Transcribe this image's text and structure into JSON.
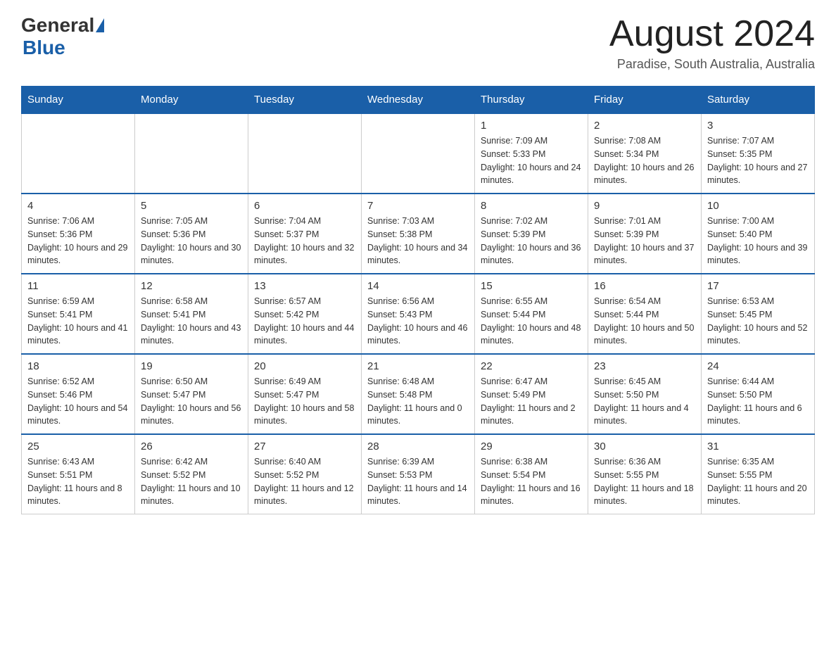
{
  "logo": {
    "general": "General",
    "blue": "Blue"
  },
  "header": {
    "title": "August 2024",
    "subtitle": "Paradise, South Australia, Australia"
  },
  "days_of_week": [
    "Sunday",
    "Monday",
    "Tuesday",
    "Wednesday",
    "Thursday",
    "Friday",
    "Saturday"
  ],
  "weeks": [
    [
      {
        "day": "",
        "info": ""
      },
      {
        "day": "",
        "info": ""
      },
      {
        "day": "",
        "info": ""
      },
      {
        "day": "",
        "info": ""
      },
      {
        "day": "1",
        "info": "Sunrise: 7:09 AM\nSunset: 5:33 PM\nDaylight: 10 hours and 24 minutes."
      },
      {
        "day": "2",
        "info": "Sunrise: 7:08 AM\nSunset: 5:34 PM\nDaylight: 10 hours and 26 minutes."
      },
      {
        "day": "3",
        "info": "Sunrise: 7:07 AM\nSunset: 5:35 PM\nDaylight: 10 hours and 27 minutes."
      }
    ],
    [
      {
        "day": "4",
        "info": "Sunrise: 7:06 AM\nSunset: 5:36 PM\nDaylight: 10 hours and 29 minutes."
      },
      {
        "day": "5",
        "info": "Sunrise: 7:05 AM\nSunset: 5:36 PM\nDaylight: 10 hours and 30 minutes."
      },
      {
        "day": "6",
        "info": "Sunrise: 7:04 AM\nSunset: 5:37 PM\nDaylight: 10 hours and 32 minutes."
      },
      {
        "day": "7",
        "info": "Sunrise: 7:03 AM\nSunset: 5:38 PM\nDaylight: 10 hours and 34 minutes."
      },
      {
        "day": "8",
        "info": "Sunrise: 7:02 AM\nSunset: 5:39 PM\nDaylight: 10 hours and 36 minutes."
      },
      {
        "day": "9",
        "info": "Sunrise: 7:01 AM\nSunset: 5:39 PM\nDaylight: 10 hours and 37 minutes."
      },
      {
        "day": "10",
        "info": "Sunrise: 7:00 AM\nSunset: 5:40 PM\nDaylight: 10 hours and 39 minutes."
      }
    ],
    [
      {
        "day": "11",
        "info": "Sunrise: 6:59 AM\nSunset: 5:41 PM\nDaylight: 10 hours and 41 minutes."
      },
      {
        "day": "12",
        "info": "Sunrise: 6:58 AM\nSunset: 5:41 PM\nDaylight: 10 hours and 43 minutes."
      },
      {
        "day": "13",
        "info": "Sunrise: 6:57 AM\nSunset: 5:42 PM\nDaylight: 10 hours and 44 minutes."
      },
      {
        "day": "14",
        "info": "Sunrise: 6:56 AM\nSunset: 5:43 PM\nDaylight: 10 hours and 46 minutes."
      },
      {
        "day": "15",
        "info": "Sunrise: 6:55 AM\nSunset: 5:44 PM\nDaylight: 10 hours and 48 minutes."
      },
      {
        "day": "16",
        "info": "Sunrise: 6:54 AM\nSunset: 5:44 PM\nDaylight: 10 hours and 50 minutes."
      },
      {
        "day": "17",
        "info": "Sunrise: 6:53 AM\nSunset: 5:45 PM\nDaylight: 10 hours and 52 minutes."
      }
    ],
    [
      {
        "day": "18",
        "info": "Sunrise: 6:52 AM\nSunset: 5:46 PM\nDaylight: 10 hours and 54 minutes."
      },
      {
        "day": "19",
        "info": "Sunrise: 6:50 AM\nSunset: 5:47 PM\nDaylight: 10 hours and 56 minutes."
      },
      {
        "day": "20",
        "info": "Sunrise: 6:49 AM\nSunset: 5:47 PM\nDaylight: 10 hours and 58 minutes."
      },
      {
        "day": "21",
        "info": "Sunrise: 6:48 AM\nSunset: 5:48 PM\nDaylight: 11 hours and 0 minutes."
      },
      {
        "day": "22",
        "info": "Sunrise: 6:47 AM\nSunset: 5:49 PM\nDaylight: 11 hours and 2 minutes."
      },
      {
        "day": "23",
        "info": "Sunrise: 6:45 AM\nSunset: 5:50 PM\nDaylight: 11 hours and 4 minutes."
      },
      {
        "day": "24",
        "info": "Sunrise: 6:44 AM\nSunset: 5:50 PM\nDaylight: 11 hours and 6 minutes."
      }
    ],
    [
      {
        "day": "25",
        "info": "Sunrise: 6:43 AM\nSunset: 5:51 PM\nDaylight: 11 hours and 8 minutes."
      },
      {
        "day": "26",
        "info": "Sunrise: 6:42 AM\nSunset: 5:52 PM\nDaylight: 11 hours and 10 minutes."
      },
      {
        "day": "27",
        "info": "Sunrise: 6:40 AM\nSunset: 5:52 PM\nDaylight: 11 hours and 12 minutes."
      },
      {
        "day": "28",
        "info": "Sunrise: 6:39 AM\nSunset: 5:53 PM\nDaylight: 11 hours and 14 minutes."
      },
      {
        "day": "29",
        "info": "Sunrise: 6:38 AM\nSunset: 5:54 PM\nDaylight: 11 hours and 16 minutes."
      },
      {
        "day": "30",
        "info": "Sunrise: 6:36 AM\nSunset: 5:55 PM\nDaylight: 11 hours and 18 minutes."
      },
      {
        "day": "31",
        "info": "Sunrise: 6:35 AM\nSunset: 5:55 PM\nDaylight: 11 hours and 20 minutes."
      }
    ]
  ]
}
